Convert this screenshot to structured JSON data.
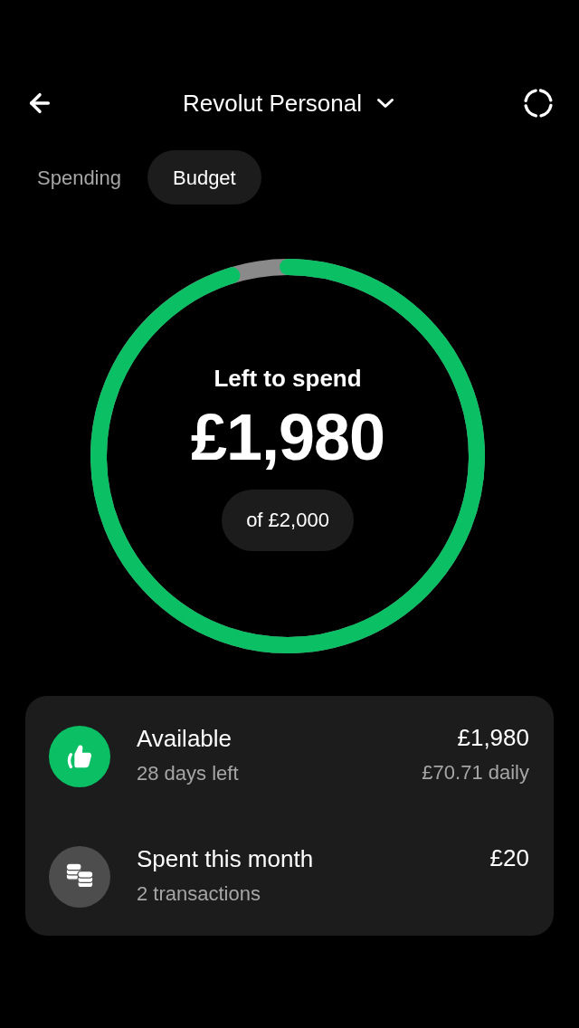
{
  "header": {
    "title": "Revolut Personal"
  },
  "tabs": [
    {
      "label": "Spending",
      "selected": false
    },
    {
      "label": "Budget",
      "selected": true
    }
  ],
  "budget": {
    "label": "Left to spend",
    "amount": "£1,980",
    "total": "of £2,000",
    "level": 0.99
  },
  "summary": [
    {
      "kind": "available",
      "color": "#0bbf64",
      "title": "Available",
      "subtitle": "28 days left",
      "amount": "£1,980",
      "detail": "£70.71 daily"
    },
    {
      "kind": "spent",
      "color": "#4d4d4d",
      "title": "Spent this month",
      "subtitle": "2 transactions",
      "amount": "£20"
    }
  ]
}
